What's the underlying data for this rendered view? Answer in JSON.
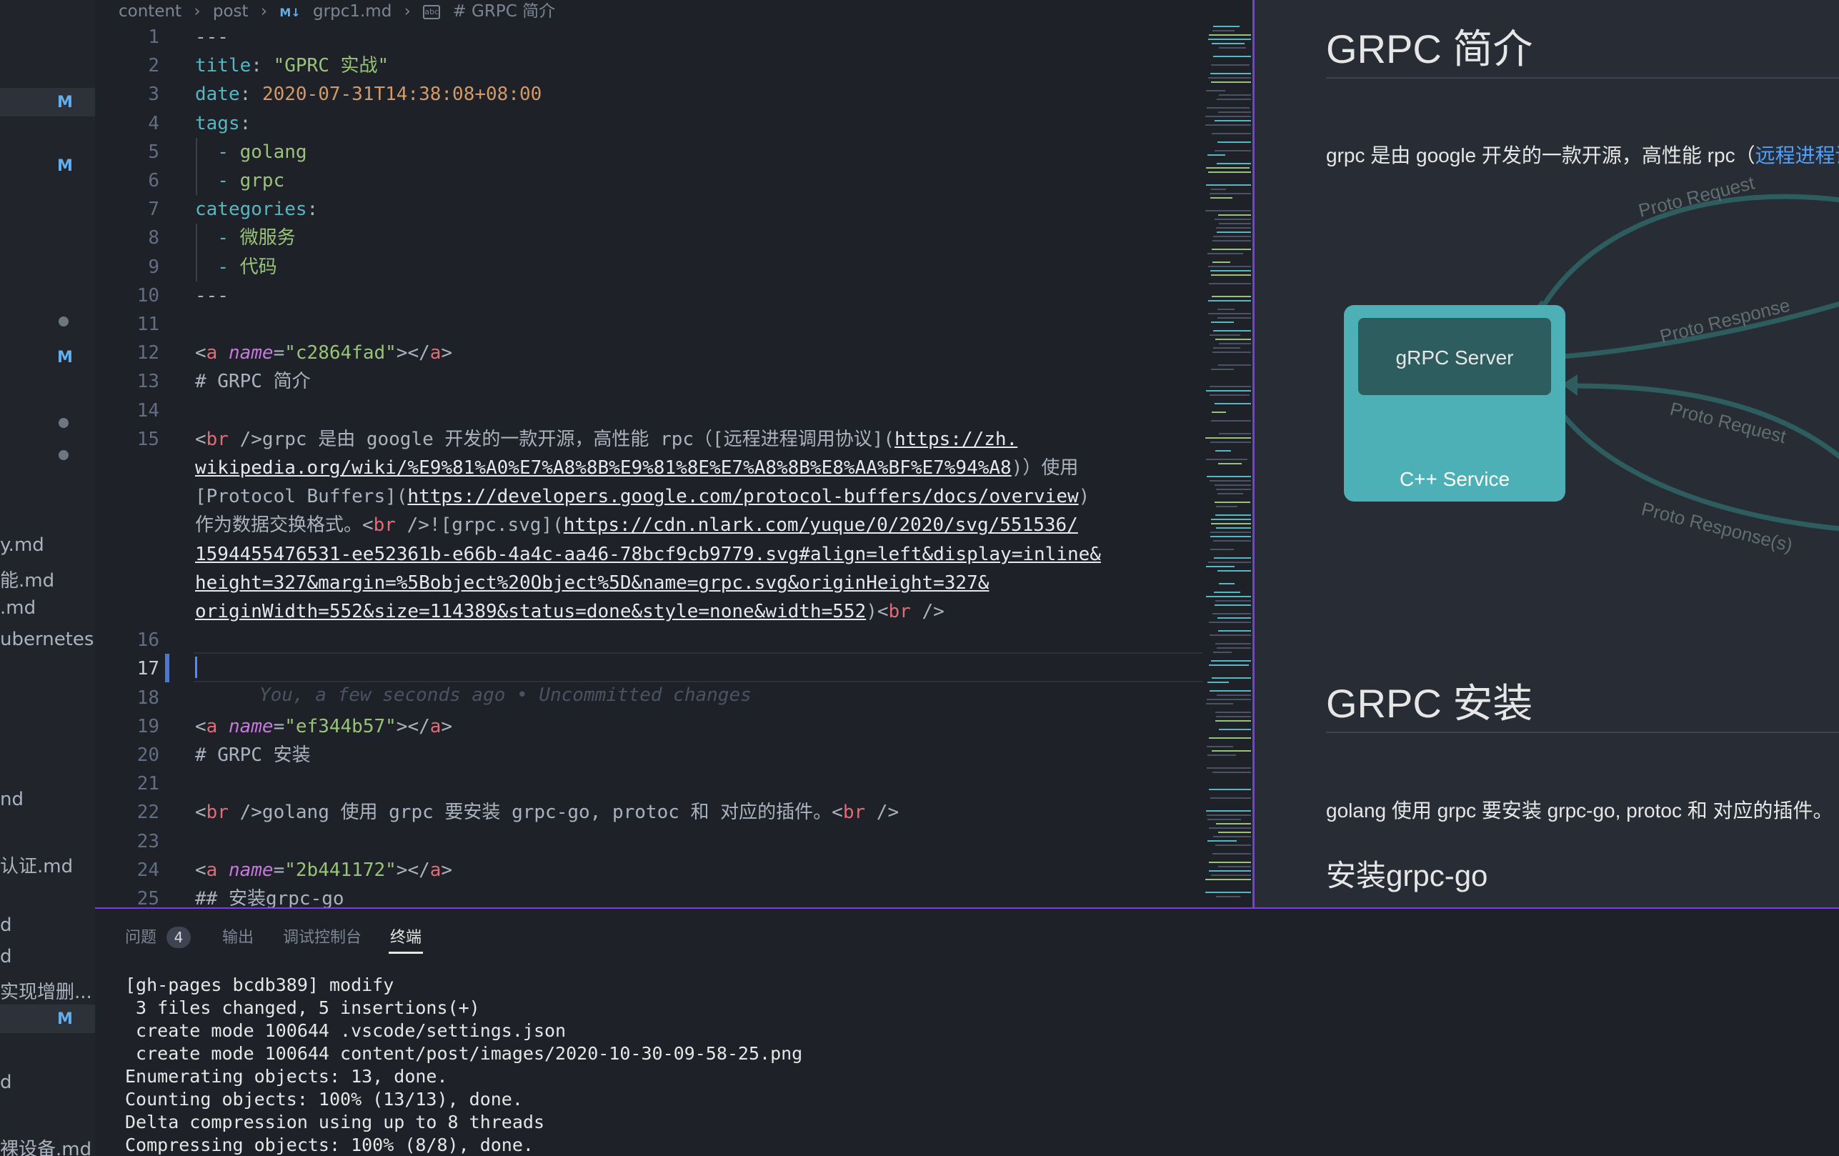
{
  "sidebar": {
    "rows": [
      {
        "text": "",
        "badge": "M",
        "dot": false,
        "selected": true
      },
      {
        "text": "",
        "badge": "M",
        "dot": false,
        "selected": false
      },
      {
        "text": "",
        "badge": "",
        "dot": true,
        "selected": false
      },
      {
        "text": "",
        "badge": "M",
        "dot": false,
        "selected": false
      },
      {
        "text": "",
        "badge": "",
        "dot": true,
        "selected": false
      },
      {
        "text": "",
        "badge": "",
        "dot": true,
        "selected": false
      },
      {
        "text": "y.md",
        "badge": "",
        "dot": false,
        "selected": false
      },
      {
        "text": "能.md",
        "badge": "",
        "dot": false,
        "selected": false
      },
      {
        "text": ".md",
        "badge": "",
        "dot": false,
        "selected": false
      },
      {
        "text": "ubernetes...",
        "badge": "",
        "dot": false,
        "selected": false
      },
      {
        "text": "nd",
        "badge": "",
        "dot": false,
        "selected": false
      },
      {
        "text": "认证.md",
        "badge": "",
        "dot": false,
        "selected": false
      },
      {
        "text": "d",
        "badge": "",
        "dot": false,
        "selected": false
      },
      {
        "text": "d",
        "badge": "",
        "dot": false,
        "selected": false
      },
      {
        "text": "实现增删...",
        "badge": "",
        "dot": false,
        "selected": false
      },
      {
        "text": "",
        "badge": "M",
        "dot": false,
        "selected": true
      },
      {
        "text": "d",
        "badge": "",
        "dot": false,
        "selected": false
      },
      {
        "text": "裸设备.md",
        "badge": "",
        "dot": false,
        "selected": false
      }
    ]
  },
  "breadcrumb": {
    "parts": [
      "content",
      "post",
      "grpc1.md",
      "# GRPC 简介"
    ],
    "md_icon": "M↓",
    "symbol_icon": "abc"
  },
  "editor": {
    "current_line": 17,
    "ghost_text": "You, a few seconds ago • Uncommitted changes",
    "lines": [
      {
        "n": 1,
        "segments": [
          [
            "p",
            "---"
          ]
        ]
      },
      {
        "n": 2,
        "segments": [
          [
            "k",
            "title"
          ],
          [
            "p",
            ": "
          ],
          [
            "s",
            "\"GPRC 实战\""
          ]
        ]
      },
      {
        "n": 3,
        "segments": [
          [
            "k",
            "date"
          ],
          [
            "p",
            ": "
          ],
          [
            "d",
            "2020-07-31T14:38:08+08:00"
          ]
        ]
      },
      {
        "n": 4,
        "segments": [
          [
            "k",
            "tags"
          ],
          [
            "p",
            ":"
          ]
        ]
      },
      {
        "n": 5,
        "segments": [
          [
            "p",
            "  "
          ],
          [
            "k",
            "- "
          ],
          [
            "s",
            "golang"
          ]
        ]
      },
      {
        "n": 6,
        "segments": [
          [
            "p",
            "  "
          ],
          [
            "k",
            "- "
          ],
          [
            "s",
            "grpc"
          ]
        ]
      },
      {
        "n": 7,
        "segments": [
          [
            "k",
            "categories"
          ],
          [
            "p",
            ":"
          ]
        ]
      },
      {
        "n": 8,
        "segments": [
          [
            "p",
            "  "
          ],
          [
            "k",
            "- "
          ],
          [
            "s",
            "微服务"
          ]
        ]
      },
      {
        "n": 9,
        "segments": [
          [
            "p",
            "  "
          ],
          [
            "k",
            "- "
          ],
          [
            "s",
            "代码"
          ]
        ]
      },
      {
        "n": 10,
        "segments": [
          [
            "p",
            "---"
          ]
        ]
      },
      {
        "n": 11,
        "segments": []
      },
      {
        "n": 12,
        "segments": [
          [
            "p",
            "<"
          ],
          [
            "t",
            "a"
          ],
          [
            "p",
            " "
          ],
          [
            "a",
            "name"
          ],
          [
            "p",
            "="
          ],
          [
            "s",
            "\"c2864fad\""
          ],
          [
            "p",
            "></"
          ],
          [
            "t",
            "a"
          ],
          [
            "p",
            ">"
          ]
        ]
      },
      {
        "n": 13,
        "segments": [
          [
            "p",
            "# GRPC 简介"
          ]
        ]
      },
      {
        "n": 14,
        "segments": []
      },
      {
        "n": 15,
        "segments": [
          [
            "p",
            "<"
          ],
          [
            "t",
            "br"
          ],
          [
            "p",
            " />grpc 是由 google 开发的一款开源，高性能 rpc（[远程进程调用协议]("
          ],
          [
            "u",
            "https://zh."
          ]
        ]
      },
      {
        "n": null,
        "segments": [
          [
            "u",
            "wikipedia.org/wiki/%E9%81%A0%E7%A8%8B%E9%81%8E%E7%A8%8B%E8%AA%BF%E7%94%A8"
          ],
          [
            "p",
            ")）使用"
          ]
        ]
      },
      {
        "n": null,
        "segments": [
          [
            "p",
            "[Protocol Buffers]("
          ],
          [
            "u",
            "https://developers.google.com/protocol-buffers/docs/overview"
          ],
          [
            "p",
            ")"
          ]
        ]
      },
      {
        "n": null,
        "segments": [
          [
            "p",
            "作为数据交换格式。<"
          ],
          [
            "t",
            "br"
          ],
          [
            "p",
            " />![grpc.svg]("
          ],
          [
            "u",
            "https://cdn.nlark.com/yuque/0/2020/svg/551536/"
          ]
        ]
      },
      {
        "n": null,
        "segments": [
          [
            "u",
            "1594455476531-ee52361b-e66b-4a4c-aa46-78bcf9cb9779.svg#align=left&display=inline&"
          ]
        ]
      },
      {
        "n": null,
        "segments": [
          [
            "u",
            "height=327&margin=%5Bobject%20Object%5D&name=grpc.svg&originHeight=327&"
          ]
        ]
      },
      {
        "n": null,
        "segments": [
          [
            "u",
            "originWidth=552&size=114389&status=done&style=none&width=552"
          ],
          [
            "p",
            ")<"
          ],
          [
            "t",
            "br"
          ],
          [
            "p",
            " />"
          ]
        ]
      },
      {
        "n": 16,
        "segments": []
      },
      {
        "n": 17,
        "segments": []
      },
      {
        "n": 18,
        "segments": []
      },
      {
        "n": 19,
        "segments": [
          [
            "p",
            "<"
          ],
          [
            "t",
            "a"
          ],
          [
            "p",
            " "
          ],
          [
            "a",
            "name"
          ],
          [
            "p",
            "="
          ],
          [
            "s",
            "\"ef344b57\""
          ],
          [
            "p",
            "></"
          ],
          [
            "t",
            "a"
          ],
          [
            "p",
            ">"
          ]
        ]
      },
      {
        "n": 20,
        "segments": [
          [
            "p",
            "# GRPC 安装"
          ]
        ]
      },
      {
        "n": 21,
        "segments": []
      },
      {
        "n": 22,
        "segments": [
          [
            "p",
            "<"
          ],
          [
            "t",
            "br"
          ],
          [
            "p",
            " />golang 使用 grpc 要安装 grpc-go, protoc 和 对应的插件。<"
          ],
          [
            "t",
            "br"
          ],
          [
            "p",
            " />"
          ]
        ]
      },
      {
        "n": 23,
        "segments": []
      },
      {
        "n": 24,
        "segments": [
          [
            "p",
            "<"
          ],
          [
            "t",
            "a"
          ],
          [
            "p",
            " "
          ],
          [
            "a",
            "name"
          ],
          [
            "p",
            "="
          ],
          [
            "s",
            "\"2b441172\""
          ],
          [
            "p",
            "></"
          ],
          [
            "t",
            "a"
          ],
          [
            "p",
            ">"
          ]
        ]
      },
      {
        "n": 25,
        "segments": [
          [
            "p",
            "## 安装grpc-go"
          ]
        ]
      }
    ]
  },
  "preview": {
    "h1_intro": "GRPC 简介",
    "intro_text": "grpc 是由 google 开发的一款开源，高性能 rpc（",
    "intro_link": "远程进程调",
    "diagram": {
      "server_label": "gRPC Server",
      "service_label": "C++ Service",
      "arrow_labels": [
        "Proto Request",
        "Proto Response",
        "Proto Request",
        "Proto Response(s)"
      ],
      "colors": {
        "box": "#4cb0b6",
        "inner": "#2d5d5e",
        "arrow": "#2d5d5e",
        "label": "#5f6f70"
      }
    },
    "h1_install": "GRPC 安装",
    "install_text": "golang 使用 grpc 要安装 grpc-go, protoc 和 对应的插件。",
    "h2_grpc_go": "安装grpc-go"
  },
  "panel": {
    "tabs": [
      {
        "label": "问题",
        "active": false
      },
      {
        "label": "输出",
        "active": false
      },
      {
        "label": "调试控制台",
        "active": false
      },
      {
        "label": "终端",
        "active": true
      }
    ],
    "problem_count": "4",
    "terminal_lines": [
      "[gh-pages bcdb389] modify",
      " 3 files changed, 5 insertions(+)",
      " create mode 100644 .vscode/settings.json",
      " create mode 100644 content/post/images/2020-10-30-09-58-25.png",
      "Enumerating objects: 13, done.",
      "Counting objects: 100% (13/13), done.",
      "Delta compression using up to 8 threads",
      "Compressing objects: 100% (8/8), done."
    ]
  },
  "colors": {
    "accent": "#7c3aed",
    "badge": "#61afef"
  }
}
